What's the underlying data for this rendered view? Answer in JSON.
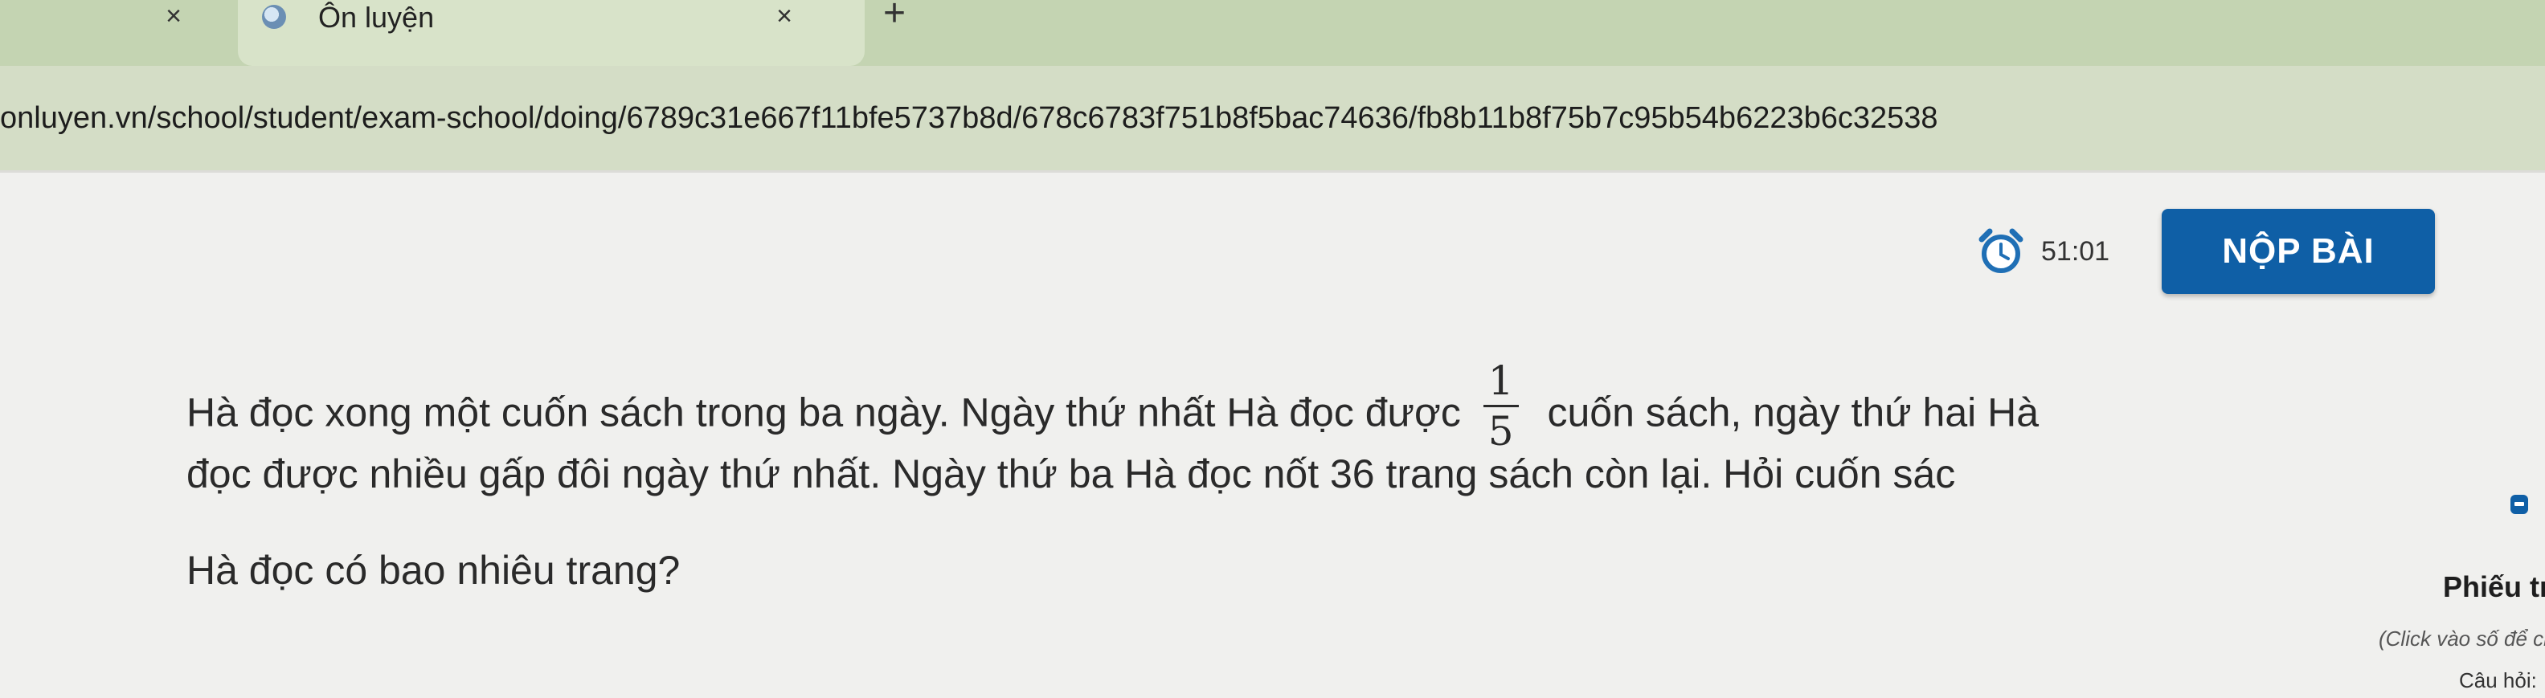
{
  "browser": {
    "prev_tab_close": "×",
    "tab": {
      "title": "Ôn luyện",
      "favicon": "onluyen-favicon-icon",
      "close": "×"
    },
    "new_tab": "+",
    "url": "onluyen.vn/school/student/exam-school/doing/6789c31e667f11bfe5737b8d/678c6783f751b8f5bac74636/fb8b11b8f75b7c95b54b6223b6c32538"
  },
  "header": {
    "timer": "51:01",
    "timer_icon": "alarm-clock-icon",
    "submit_label": "NỘP BÀI"
  },
  "question": {
    "line1_before": "Hà đọc xong một cuốn sách trong ba ngày. Ngày thứ nhất Hà đọc được",
    "fraction_num": "1",
    "fraction_den": "5",
    "line1_after": "cuốn sách, ngày thứ hai Hà",
    "line2": "đọc được nhiều gấp đôi ngày thứ nhất. Ngày thứ ba Hà đọc nốt 36 trang sách còn lại. Hỏi cuốn sác",
    "line3": "Hà đọc có bao nhiêu trang?"
  },
  "side_panel": {
    "title": "Phiếu tr",
    "note": "(Click vào số để chuy",
    "label": "Câu hỏi:"
  },
  "colors": {
    "accent": "#0f5fa6",
    "tabstrip": "#c4d4b2",
    "timer_icon": "#1f6fb5"
  }
}
